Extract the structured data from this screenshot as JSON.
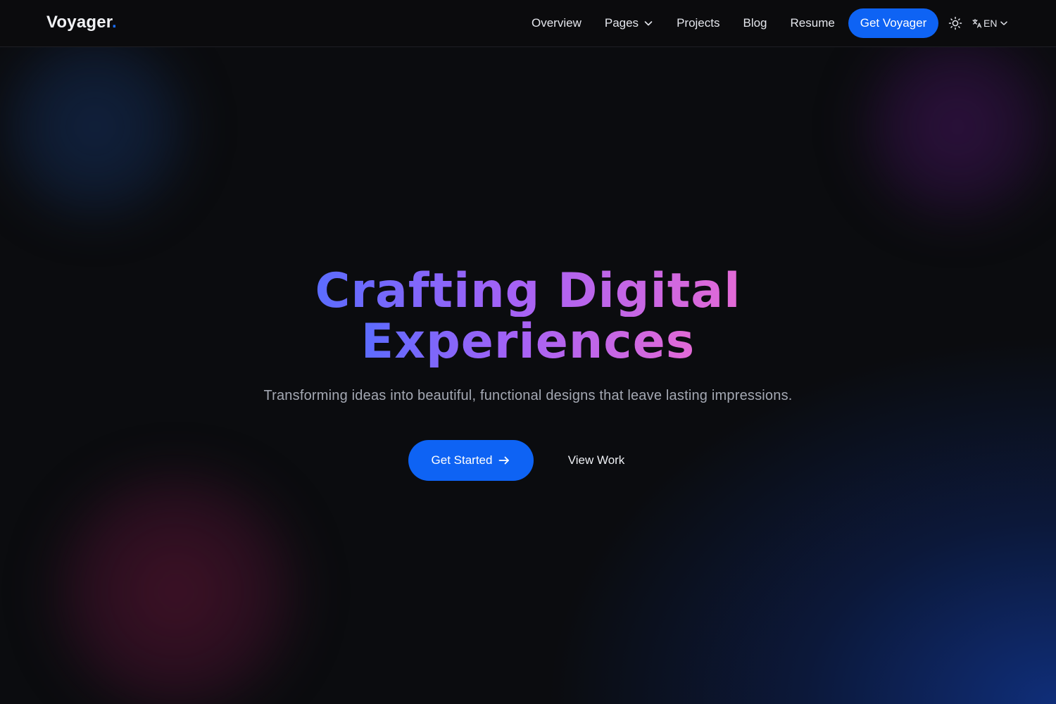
{
  "nav": {
    "logo_text": "Voyager",
    "logo_dot": ".",
    "links": [
      {
        "label": "Overview"
      },
      {
        "label": "Pages",
        "icon": "chevron-down-icon"
      },
      {
        "label": "Projects"
      },
      {
        "label": "Blog"
      },
      {
        "label": "Resume"
      }
    ],
    "cta_label": "Get Voyager",
    "theme_icon": "sun-icon",
    "language": {
      "icon": "translate-icon",
      "label": "EN",
      "dropdown_icon": "chevron-down-icon"
    }
  },
  "hero": {
    "title_line1": "Crafting Digital",
    "title_line2": "Experiences",
    "subtitle": "Transforming ideas into beautiful, functional designs that leave lasting impressions.",
    "primary_button": {
      "label": "Get Started",
      "icon": "arrow-right-icon"
    },
    "secondary_button": {
      "label": "View Work"
    }
  },
  "colors": {
    "accent": "#0e63f4",
    "background": "#0b0c0f",
    "gradient": [
      "#5b6cff",
      "#a362f6",
      "#e36ad6"
    ]
  }
}
